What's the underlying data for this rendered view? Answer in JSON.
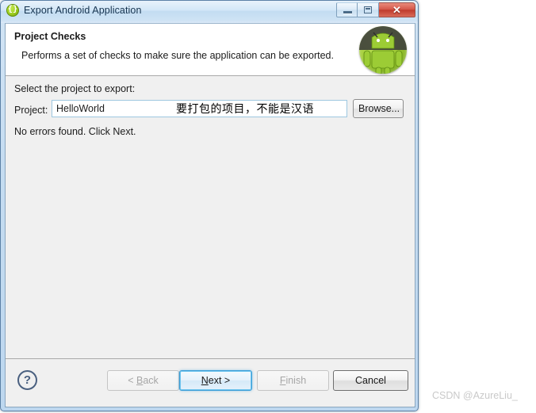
{
  "window": {
    "title": "Export Android Application",
    "app_icon": "braces-icon",
    "controls": {
      "minimize": "minimize-icon",
      "maximize": "restore-icon",
      "close": "✕"
    }
  },
  "header": {
    "title": "Project Checks",
    "description": "Performs a set of checks to make sure the application can be exported.",
    "icon": "android-robot-icon"
  },
  "body": {
    "select_label": "Select the project to export:",
    "project_label": "Project:",
    "project_value": "HelloWorld",
    "project_placeholder": "",
    "browse_label": "Browse...",
    "status_message": "No errors found. Click Next.",
    "annotation": "要打包的项目，不能是汉语"
  },
  "footer": {
    "help": "?",
    "back_label": "< Back",
    "next_label": "Next >",
    "next_accel": "N",
    "back_accel": "B",
    "finish_label": "Finish",
    "finish_accel": "F",
    "cancel_label": "Cancel"
  },
  "watermark": "CSDN @AzureLiu_",
  "colors": {
    "accent": "#3c9fd8",
    "android_green": "#a4ce3a",
    "close_red": "#d5584a",
    "titlebar_blue": "#cfe3f4"
  }
}
